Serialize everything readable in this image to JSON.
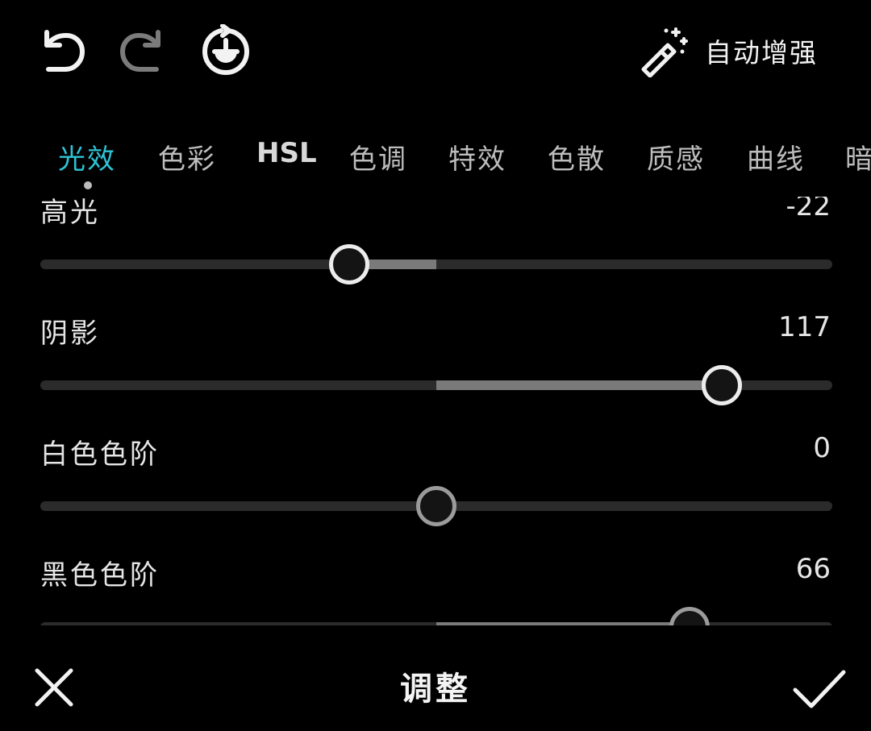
{
  "toolbar": {
    "undo_icon": "undo-icon",
    "redo_icon": "redo-icon",
    "history_icon": "history-icon",
    "auto_enhance_icon": "magic-wand-icon",
    "auto_enhance_label": "自动增强"
  },
  "tabs": [
    {
      "label": "光效",
      "active": true
    },
    {
      "label": "色彩"
    },
    {
      "label": "HSL"
    },
    {
      "label": "色调"
    },
    {
      "label": "特效"
    },
    {
      "label": "色散"
    },
    {
      "label": "质感"
    },
    {
      "label": "曲线"
    },
    {
      "label": "暗"
    }
  ],
  "sliders": [
    {
      "label": "高光",
      "value": "-22",
      "level": 0.39
    },
    {
      "label": "阴影",
      "value": "117",
      "level": 0.86
    },
    {
      "label": "白色色阶",
      "value": "0",
      "level": 0.5
    },
    {
      "label": "黑色色阶",
      "value": "66",
      "level": 0.82
    }
  ],
  "bottom": {
    "title": "调整",
    "cancel_icon": "close-icon",
    "confirm_icon": "check-icon"
  },
  "colors": {
    "accent": "#2ec4d6",
    "background": "#000000",
    "track": "#2b2b2b",
    "fill": "#7a7a7a"
  }
}
